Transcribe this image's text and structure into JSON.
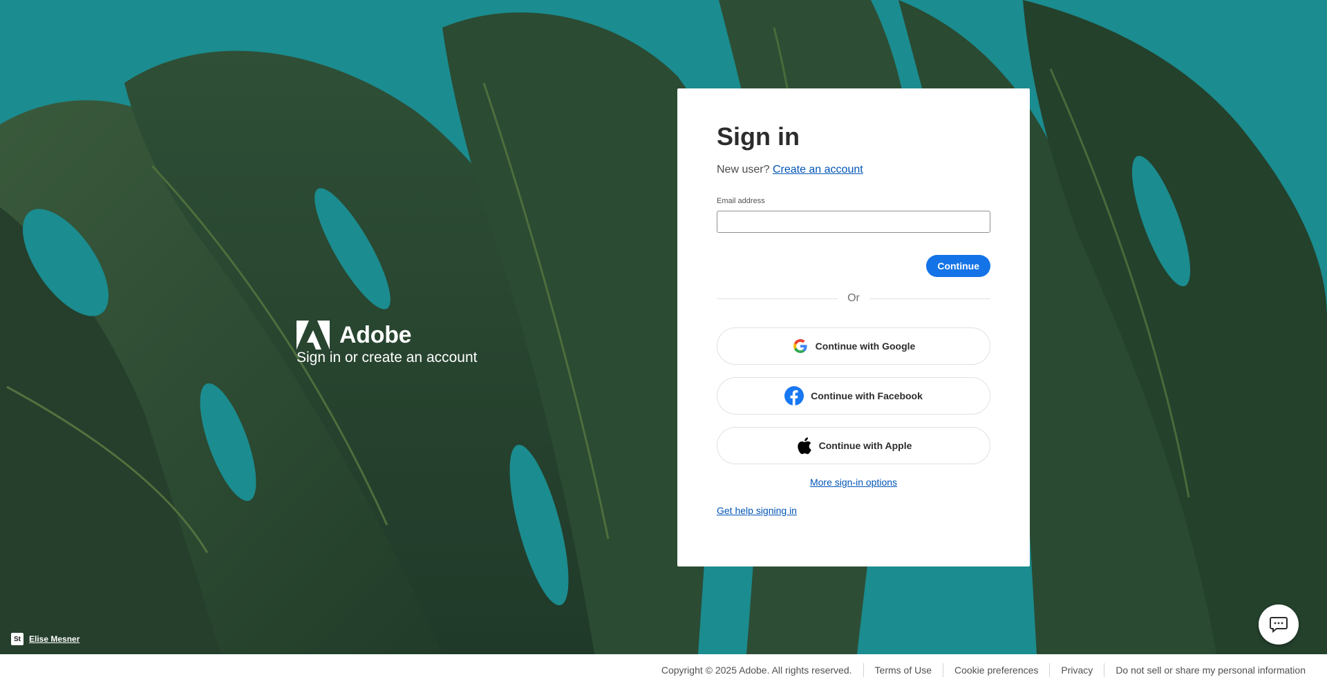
{
  "brand": {
    "name": "Adobe",
    "tagline": "Sign in or create an account"
  },
  "signin": {
    "title": "Sign in",
    "new_user_text": "New user?",
    "create_account_link": "Create an account",
    "email_label": "Email address",
    "email_value": "",
    "continue_label": "Continue",
    "divider_text": "Or",
    "social_buttons": [
      {
        "label": "Continue with Google",
        "icon": "google-icon"
      },
      {
        "label": "Continue with Facebook",
        "icon": "facebook-icon"
      },
      {
        "label": "Continue with Apple",
        "icon": "apple-icon"
      }
    ],
    "more_options_link": "More sign-in options",
    "help_link": "Get help signing in"
  },
  "photo_credit": {
    "badge": "St",
    "author": "Elise Mesner"
  },
  "footer": {
    "copyright": "Copyright © 2025 Adobe. All rights reserved.",
    "links": [
      "Terms of Use",
      "Cookie preferences",
      "Privacy",
      "Do not sell or share my personal information"
    ]
  },
  "colors": {
    "background": "#1b8c8f",
    "leaf": "#2c4a34",
    "primary_button": "#1473e6",
    "link": "#0054b6"
  }
}
